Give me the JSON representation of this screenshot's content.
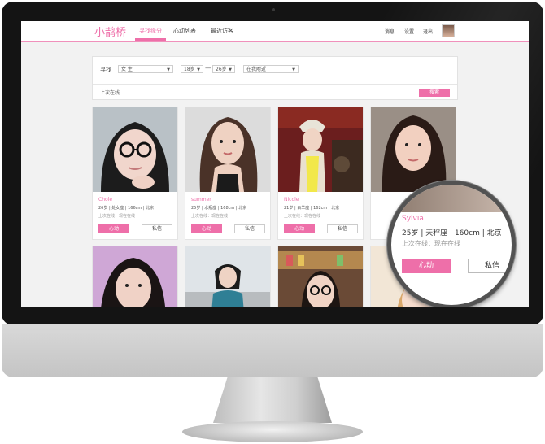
{
  "app": {
    "logo": "小鹊桥"
  },
  "nav": {
    "items": [
      {
        "label": "寻找缘分",
        "active": true
      },
      {
        "label": "心动列表",
        "active": false
      },
      {
        "label": "最近访客",
        "active": false
      }
    ]
  },
  "user_menu": {
    "messages": "消息",
    "settings": "设置",
    "logout": "退出"
  },
  "search": {
    "label": "寻找",
    "gender": "女 生",
    "age_from": "18岁",
    "age_to": "26岁",
    "location": "在我附近",
    "tab": "上次在线",
    "button": "搜索"
  },
  "profiles": [
    {
      "name": "Chole",
      "info": "26岁 | 处女座 | 166cm | 北京",
      "online": "上次在线：现在在线",
      "like": "心动",
      "message": "私信"
    },
    {
      "name": "summer",
      "info": "25岁 | 水瓶座 | 168cm | 北京",
      "online": "上次在线：现在在线",
      "like": "心动",
      "message": "私信"
    },
    {
      "name": "Nicole",
      "info": "21岁 | 白羊座 | 162cm | 北京",
      "online": "上次在线：现在在线",
      "like": "心动",
      "message": "私信"
    },
    {
      "name": "Sylvia",
      "info": "25岁 | 天秤座 | 160cm | 北京",
      "online": "上次在线：现在在线",
      "like": "心动",
      "message": "私信"
    }
  ],
  "colors": {
    "accent": "#ee6fa9",
    "screen_bg": "#f2f2f2",
    "bezel": "#141414"
  }
}
